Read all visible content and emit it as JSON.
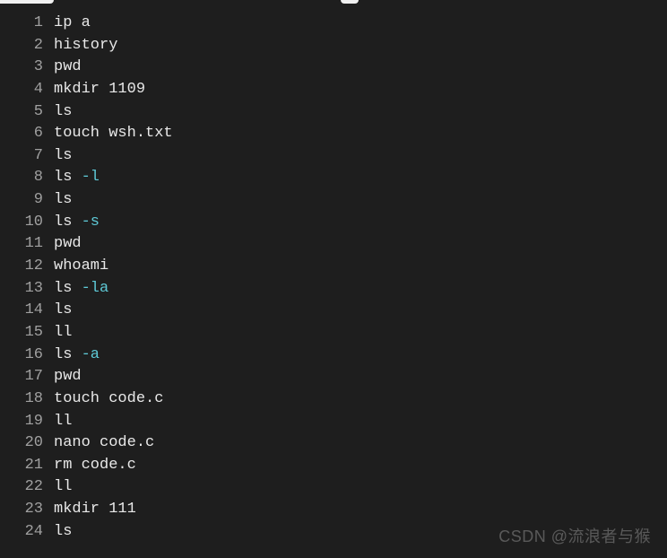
{
  "history": [
    {
      "num": "1",
      "parts": [
        {
          "t": "ip a",
          "c": "cmd"
        }
      ]
    },
    {
      "num": "2",
      "parts": [
        {
          "t": "history",
          "c": "cmd"
        }
      ]
    },
    {
      "num": "3",
      "parts": [
        {
          "t": "pwd",
          "c": "cmd"
        }
      ]
    },
    {
      "num": "4",
      "parts": [
        {
          "t": "mkdir 1109",
          "c": "cmd"
        }
      ]
    },
    {
      "num": "5",
      "parts": [
        {
          "t": "ls",
          "c": "cmd"
        }
      ]
    },
    {
      "num": "6",
      "parts": [
        {
          "t": "touch wsh.txt",
          "c": "cmd"
        }
      ]
    },
    {
      "num": "7",
      "parts": [
        {
          "t": "ls",
          "c": "cmd"
        }
      ]
    },
    {
      "num": "8",
      "parts": [
        {
          "t": "ls ",
          "c": "cmd"
        },
        {
          "t": "-l",
          "c": "flag"
        }
      ]
    },
    {
      "num": "9",
      "parts": [
        {
          "t": "ls",
          "c": "cmd"
        }
      ]
    },
    {
      "num": "10",
      "parts": [
        {
          "t": "ls ",
          "c": "cmd"
        },
        {
          "t": "-s",
          "c": "flag"
        }
      ]
    },
    {
      "num": "11",
      "parts": [
        {
          "t": "pwd",
          "c": "cmd"
        }
      ]
    },
    {
      "num": "12",
      "parts": [
        {
          "t": "whoami",
          "c": "cmd"
        }
      ]
    },
    {
      "num": "13",
      "parts": [
        {
          "t": "ls ",
          "c": "cmd"
        },
        {
          "t": "-la",
          "c": "flag"
        }
      ]
    },
    {
      "num": "14",
      "parts": [
        {
          "t": "ls",
          "c": "cmd"
        }
      ]
    },
    {
      "num": "15",
      "parts": [
        {
          "t": "ll",
          "c": "cmd"
        }
      ]
    },
    {
      "num": "16",
      "parts": [
        {
          "t": "ls ",
          "c": "cmd"
        },
        {
          "t": "-a",
          "c": "flag"
        }
      ]
    },
    {
      "num": "17",
      "parts": [
        {
          "t": "pwd",
          "c": "cmd"
        }
      ]
    },
    {
      "num": "18",
      "parts": [
        {
          "t": "touch code.c",
          "c": "cmd"
        }
      ]
    },
    {
      "num": "19",
      "parts": [
        {
          "t": "ll",
          "c": "cmd"
        }
      ]
    },
    {
      "num": "20",
      "parts": [
        {
          "t": "nano code.c",
          "c": "cmd"
        }
      ]
    },
    {
      "num": "21",
      "parts": [
        {
          "t": "rm code.c",
          "c": "cmd"
        }
      ]
    },
    {
      "num": "22",
      "parts": [
        {
          "t": "ll",
          "c": "cmd"
        }
      ]
    },
    {
      "num": "23",
      "parts": [
        {
          "t": "mkdir 111",
          "c": "cmd"
        }
      ]
    },
    {
      "num": "24",
      "parts": [
        {
          "t": "ls",
          "c": "cmd"
        }
      ]
    }
  ],
  "watermark": "CSDN @流浪者与猴"
}
